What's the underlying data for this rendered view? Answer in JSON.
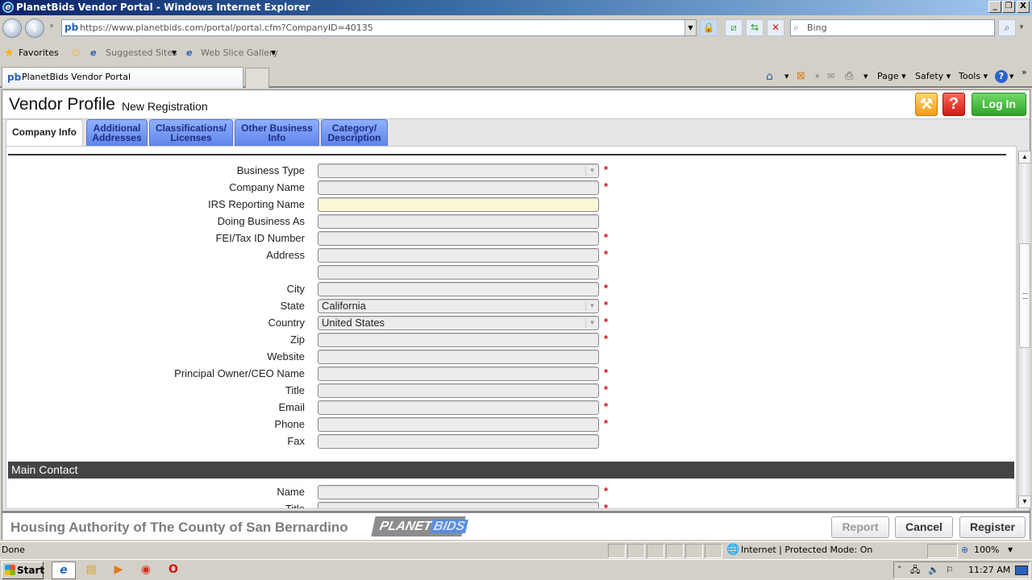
{
  "window": {
    "title": "PlanetBids Vendor Portal - Windows Internet Explorer",
    "buttons": {
      "minimize": "_",
      "restore": "❐",
      "close": "X"
    }
  },
  "browser": {
    "url": "https://www.planetbids.com/portal/portal.cfm?CompanyID=40135",
    "search_placeholder": "Bing",
    "favorites": {
      "label": "Favorites",
      "items": [
        "Suggested Sites",
        "Web Slice Gallery"
      ]
    },
    "tab_title": "PlanetBids Vendor Portal",
    "commands": [
      "Page",
      "Safety",
      "Tools"
    ],
    "status_text": "Done",
    "zone_text": "Internet | Protected Mode: On",
    "zoom": "100%"
  },
  "page": {
    "title": "Vendor Profile",
    "subtitle": "New Registration",
    "login_label": "Log In",
    "tools_icon": "tools-icon",
    "help_icon": "help-icon",
    "tabs": [
      {
        "label": "Company Info",
        "active": true
      },
      {
        "label": "Additional Addresses",
        "active": false
      },
      {
        "label": "Classifications/ Licenses",
        "active": false
      },
      {
        "label": "Other Business Info",
        "active": false
      },
      {
        "label": "Category/ Description",
        "active": false
      }
    ],
    "fields": [
      {
        "label": "Business Type",
        "value": "",
        "type": "select",
        "required": true
      },
      {
        "label": "Company Name",
        "value": "",
        "type": "text",
        "required": true
      },
      {
        "label": "IRS Reporting Name",
        "value": "",
        "type": "text",
        "required": false,
        "highlight": true
      },
      {
        "label": "Doing Business As",
        "value": "",
        "type": "text",
        "required": false
      },
      {
        "label": "FEI/Tax ID Number",
        "value": "",
        "type": "text",
        "required": true
      },
      {
        "label": "Address",
        "value": "",
        "type": "text",
        "required": true
      },
      {
        "label": "",
        "value": "",
        "type": "text",
        "required": false
      },
      {
        "label": "City",
        "value": "",
        "type": "text",
        "required": true
      },
      {
        "label": "State",
        "value": "California",
        "type": "select",
        "required": true
      },
      {
        "label": "Country",
        "value": "United States",
        "type": "select",
        "required": true
      },
      {
        "label": "Zip",
        "value": "",
        "type": "text",
        "required": true
      },
      {
        "label": "Website",
        "value": "",
        "type": "text",
        "required": false
      },
      {
        "label": "Principal Owner/CEO Name",
        "value": "",
        "type": "text",
        "required": true
      },
      {
        "label": "Title",
        "value": "",
        "type": "text",
        "required": true
      },
      {
        "label": "Email",
        "value": "",
        "type": "text",
        "required": true
      },
      {
        "label": "Phone",
        "value": "",
        "type": "text",
        "required": true
      },
      {
        "label": "Fax",
        "value": "",
        "type": "text",
        "required": false
      }
    ],
    "main_contact": {
      "heading": "Main Contact",
      "fields": [
        {
          "label": "Name",
          "value": "",
          "type": "text",
          "required": true
        },
        {
          "label": "Title",
          "value": "",
          "type": "text",
          "required": true
        }
      ]
    },
    "required_marker": "*",
    "footer": {
      "organization": "Housing Authority of The County of San Bernardino",
      "logo_part1": "PLANET",
      "logo_part2": "BIDS",
      "buttons": {
        "report": "Report",
        "cancel": "Cancel",
        "register": "Register"
      }
    },
    "scroll_position": 0.35
  },
  "taskbar": {
    "start_label": "Start",
    "apps": [
      "internet-explorer",
      "file-explorer",
      "media-player",
      "chrome",
      "opera"
    ],
    "clock": "11:27 AM"
  }
}
